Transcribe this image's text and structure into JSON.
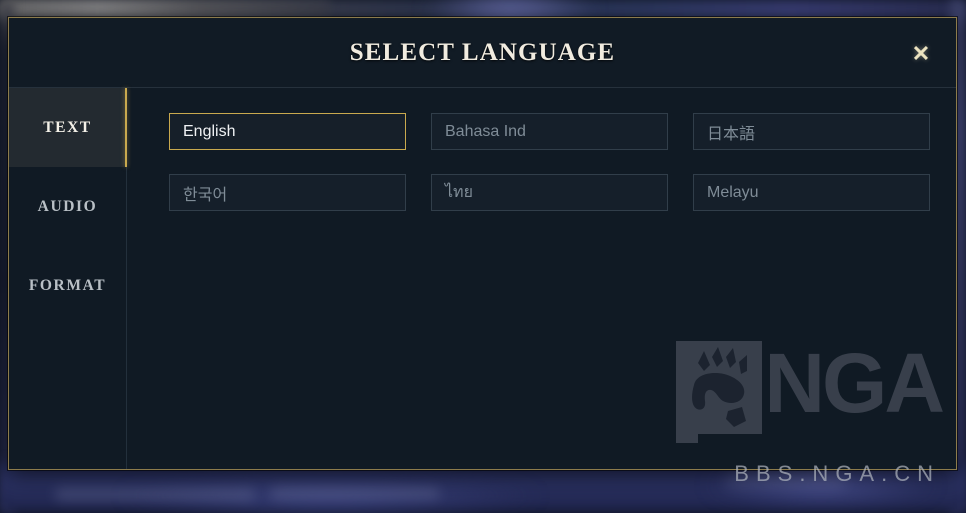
{
  "dialog": {
    "title": "SELECT LANGUAGE",
    "close_label": "✕",
    "close_icon": "close-icon",
    "accent_color": "#c9a94e",
    "border_color": "#8d7c4c",
    "background_color": "#101a24"
  },
  "sidebar": {
    "items": [
      {
        "label": "TEXT",
        "active": true
      },
      {
        "label": "AUDIO",
        "active": false
      },
      {
        "label": "FORMAT",
        "active": false
      }
    ]
  },
  "languages": [
    {
      "label": "English",
      "selected": true
    },
    {
      "label": "Bahasa Ind",
      "selected": false
    },
    {
      "label": "日本語",
      "selected": false
    },
    {
      "label": "한국어",
      "selected": false
    },
    {
      "label": "ไทย",
      "selected": false
    },
    {
      "label": "Melayu",
      "selected": false
    }
  ],
  "watermark": {
    "brand": "NGA",
    "url": "BBS.NGA.CN",
    "paw_icon": "bear-paw-icon",
    "color": "#3b424e"
  }
}
